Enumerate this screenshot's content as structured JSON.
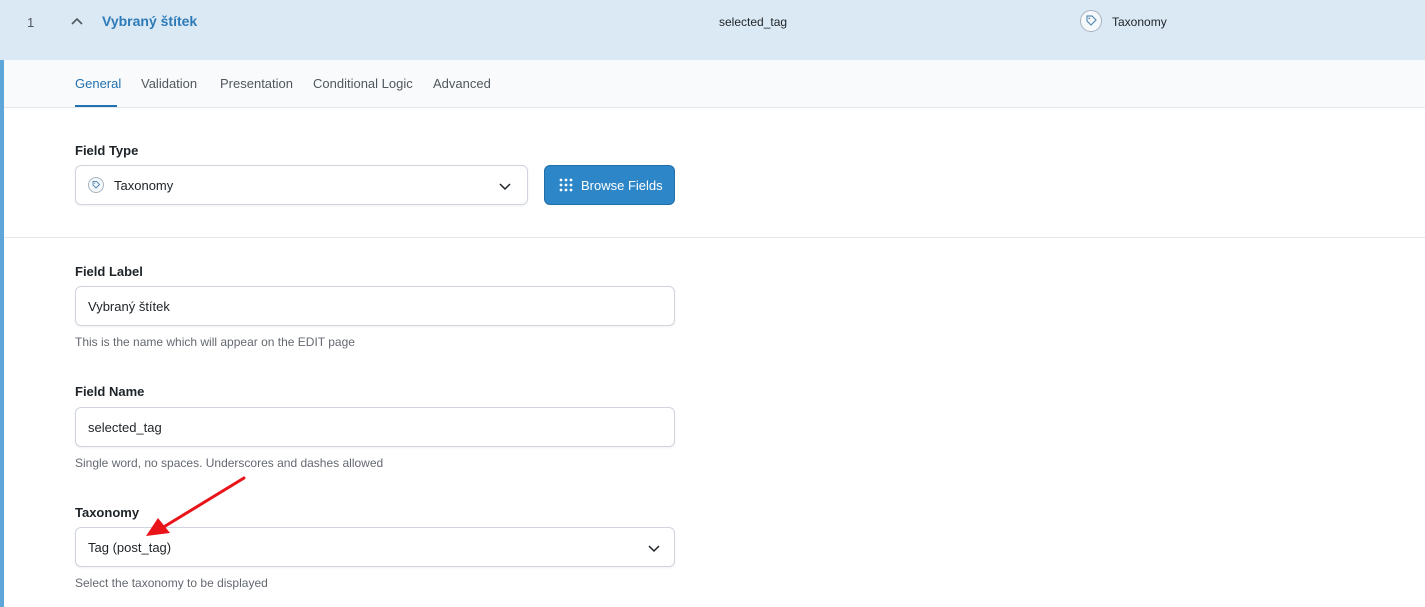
{
  "header": {
    "order": "1",
    "label": "Vybraný štítek",
    "name": "selected_tag",
    "type": "Taxonomy"
  },
  "tabs": [
    {
      "label": "General",
      "active": true
    },
    {
      "label": "Validation",
      "active": false
    },
    {
      "label": "Presentation",
      "active": false
    },
    {
      "label": "Conditional Logic",
      "active": false
    },
    {
      "label": "Advanced",
      "active": false
    }
  ],
  "field_type": {
    "label": "Field Type",
    "value": "Taxonomy",
    "browse_button": "Browse Fields"
  },
  "field_label": {
    "label": "Field Label",
    "value": "Vybraný štítek",
    "help": "This is the name which will appear on the EDIT page"
  },
  "field_name": {
    "label": "Field Name",
    "value": "selected_tag",
    "help": "Single word, no spaces. Underscores and dashes allowed"
  },
  "taxonomy": {
    "label": "Taxonomy",
    "value": "Tag (post_tag)",
    "help": "Select the taxonomy to be displayed"
  },
  "icons": {
    "toggle": "chevron-up-icon",
    "type": "tag-icon",
    "dropdown": "chevron-down-icon",
    "browse": "grid-icon",
    "annotation": "red-arrow"
  },
  "colors": {
    "header_bg": "#dbe9f5",
    "accent": "#2271b1",
    "button_bg": "#2d86c7",
    "annotation_arrow": "#e8141a"
  }
}
